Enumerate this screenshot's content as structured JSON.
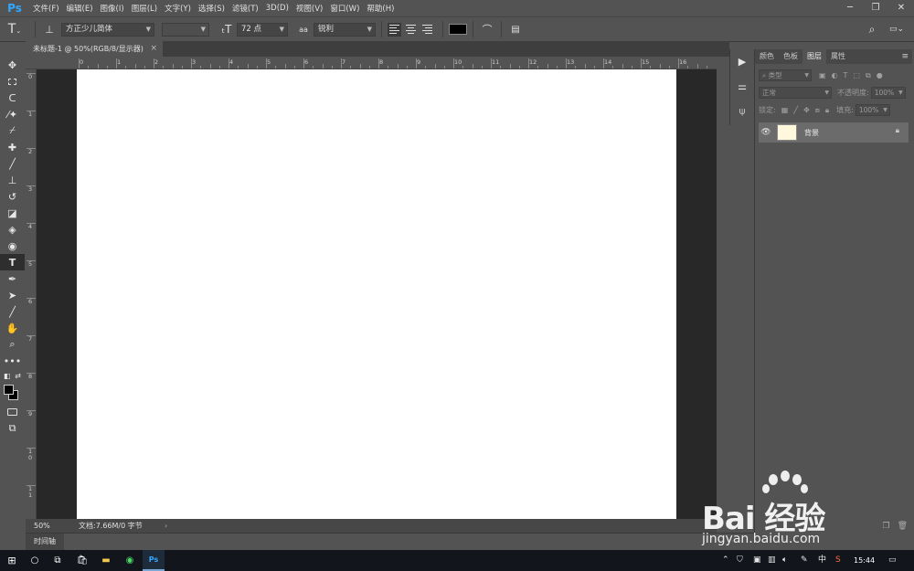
{
  "app": {
    "logo": "Ps",
    "menu": [
      "文件(F)",
      "编辑(E)",
      "图像(I)",
      "图层(L)",
      "文字(Y)",
      "选择(S)",
      "滤镜(T)",
      "3D(D)",
      "视图(V)",
      "窗口(W)",
      "帮助(H)"
    ],
    "window_controls": [
      "minimize-icon",
      "restore-icon",
      "close-icon"
    ]
  },
  "options": {
    "font_family": "方正少儿简体",
    "font_style": "",
    "font_size": "72 点",
    "antialias_label": "aa",
    "antialias": "锐利",
    "text_color": "#000000"
  },
  "document": {
    "tab_title": "未标题-1 @ 50%(RGB/8/显示器)",
    "tab_close": "×",
    "zoom": "50%",
    "doc_info": "文档:7.66M/0 字节",
    "status_arrow": "›",
    "ruler_top": [
      "0",
      "1",
      "2",
      "3",
      "4",
      "5",
      "6",
      "7",
      "8",
      "9",
      "10",
      "11",
      "12",
      "13",
      "14",
      "15",
      "16"
    ],
    "ruler_left": [
      "0",
      "1",
      "2",
      "3",
      "4",
      "5",
      "6",
      "7",
      "8",
      "9",
      "10",
      "11"
    ]
  },
  "timeline": {
    "label": "时间轴"
  },
  "panel": {
    "tabs": [
      "颜色",
      "色板",
      "图层",
      "属性"
    ],
    "active_tab": "图层",
    "filter_placeholder": "类型",
    "blend_mode": "正常",
    "opacity_label": "不透明度:",
    "opacity_value": "100%",
    "lock_label": "锁定:",
    "fill_label": "填充:",
    "fill_value": "100%",
    "layer_name": "背景",
    "layer_thumb_color": "#fff8dc"
  },
  "taskbar": {
    "time": "15:44",
    "ime": "中",
    "tray_icons": [
      "up-arrow-icon",
      "defender-icon",
      "network-icon",
      "volume-icon",
      "wifi-icon",
      "pen-icon",
      "ime-icon",
      "sogou-icon",
      "notification-icon"
    ]
  },
  "watermark": {
    "brand": "Bai  经验",
    "url": "jingyan.baidu.com"
  }
}
